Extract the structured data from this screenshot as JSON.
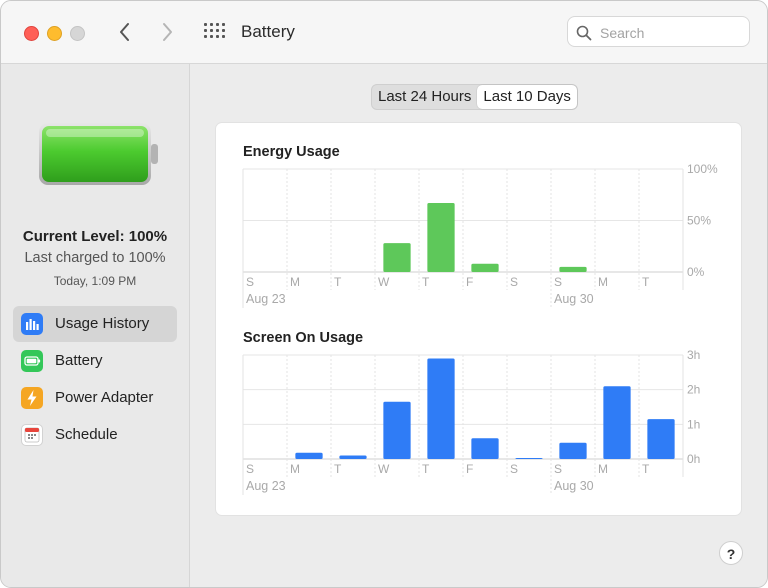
{
  "window": {
    "title": "Battery"
  },
  "search": {
    "placeholder": "Search"
  },
  "battery": {
    "current_level": "Current Level: 100%",
    "last_charged": "Last charged to 100%",
    "time": "Today, 1:09 PM",
    "level": 1.0
  },
  "sidebar": {
    "items": [
      {
        "label": "Usage History",
        "icon": "bar-chart-icon",
        "color": "#2f7cf6",
        "active": true
      },
      {
        "label": "Battery",
        "icon": "battery-icon",
        "color": "#34c759",
        "active": false
      },
      {
        "label": "Power Adapter",
        "icon": "lightning-icon",
        "color": "#f5a623",
        "active": false
      },
      {
        "label": "Schedule",
        "icon": "calendar-icon",
        "color": "#ffffff",
        "active": false
      }
    ]
  },
  "segments": {
    "left": "Last 24 Hours",
    "right": "Last 10 Days",
    "selected": "Last 10 Days"
  },
  "colors": {
    "energy": "#5ec85a",
    "screen": "#2f7cf6"
  },
  "chart_data": [
    {
      "type": "bar",
      "title": "Energy Usage",
      "categories": [
        "S",
        "M",
        "T",
        "W",
        "T",
        "F",
        "S",
        "S",
        "M",
        "T"
      ],
      "date_labels": [
        "Aug 23",
        "",
        "",
        "",
        "",
        "",
        "",
        "Aug 30",
        "",
        ""
      ],
      "values": [
        0,
        0,
        0,
        28,
        67,
        8,
        0,
        5,
        0,
        0
      ],
      "ylim": [
        0,
        100
      ],
      "yticks": [
        "100%",
        "50%",
        "0%"
      ],
      "grid": true
    },
    {
      "type": "bar",
      "title": "Screen On Usage",
      "categories": [
        "S",
        "M",
        "T",
        "W",
        "T",
        "F",
        "S",
        "S",
        "M",
        "T"
      ],
      "date_labels": [
        "Aug 23",
        "",
        "",
        "",
        "",
        "",
        "",
        "Aug 30",
        "",
        ""
      ],
      "values": [
        0,
        0.18,
        0.1,
        1.65,
        2.9,
        0.6,
        0.03,
        0.47,
        2.1,
        1.15
      ],
      "ylim": [
        0,
        3
      ],
      "yticks": [
        "3h",
        "2h",
        "1h",
        "0h"
      ],
      "grid": true
    }
  ],
  "help": {
    "label": "?"
  }
}
